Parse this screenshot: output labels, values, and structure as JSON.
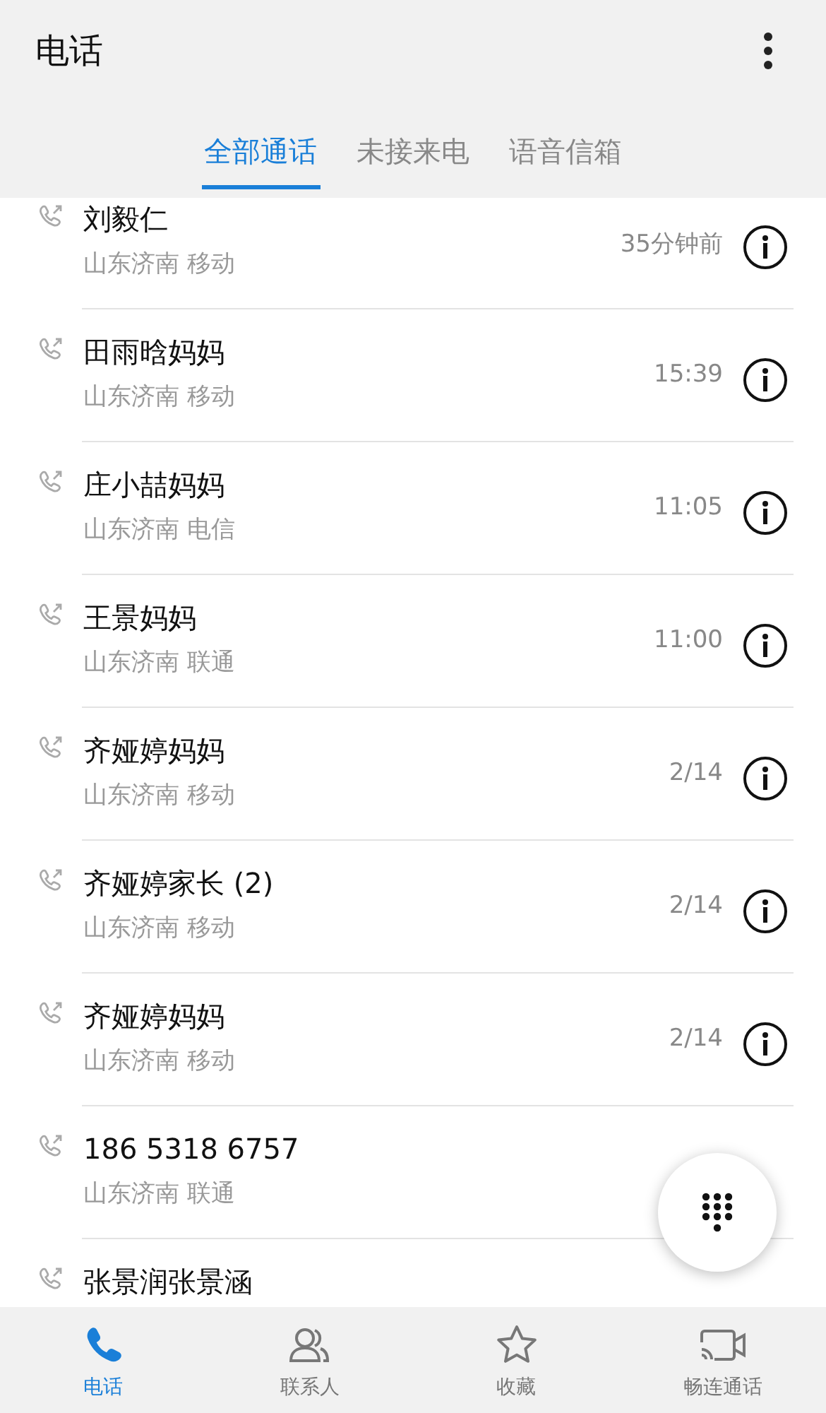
{
  "app_bar": {
    "title": "电话"
  },
  "tabs": [
    {
      "label": "全部通话",
      "selected": true
    },
    {
      "label": "未接来电",
      "selected": false
    },
    {
      "label": "语音信箱",
      "selected": false
    }
  ],
  "calls": [
    {
      "name": "刘毅仁",
      "location": "山东济南 移动",
      "time": "35分钟前"
    },
    {
      "name": "田雨晗妈妈",
      "location": "山东济南 移动",
      "time": "15:39"
    },
    {
      "name": "庄小喆妈妈",
      "location": "山东济南 电信",
      "time": "11:05"
    },
    {
      "name": "王景妈妈",
      "location": "山东济南 联通",
      "time": "11:00"
    },
    {
      "name": "齐娅婷妈妈",
      "location": "山东济南 移动",
      "time": "2/14"
    },
    {
      "name": "齐娅婷家长 (2)",
      "location": "山东济南 移动",
      "time": "2/14"
    },
    {
      "name": "齐娅婷妈妈",
      "location": "山东济南 移动",
      "time": "2/14"
    },
    {
      "name": "186 5318 6757",
      "location": "山东济南 联通"
    },
    {
      "name": "张景润张景涵"
    }
  ],
  "bottom_nav": [
    {
      "label": "电话",
      "kind": "phone",
      "selected": true
    },
    {
      "label": "联系人",
      "kind": "contacts",
      "selected": false
    },
    {
      "label": "收藏",
      "kind": "star",
      "selected": false
    },
    {
      "label": "畅连通话",
      "kind": "video",
      "selected": false
    }
  ]
}
